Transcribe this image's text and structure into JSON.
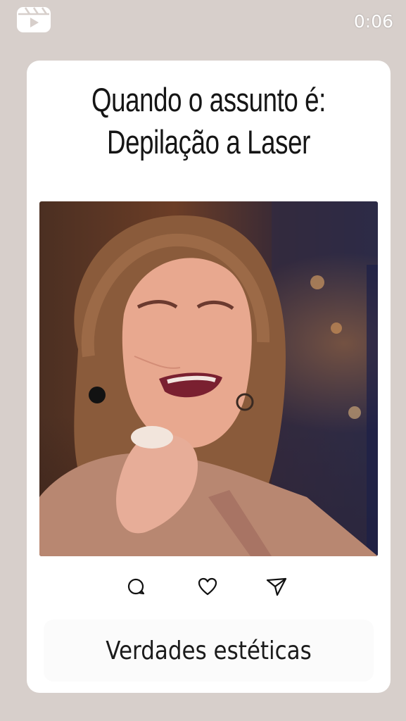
{
  "header": {
    "icon": "reels-icon",
    "timer": "0:06"
  },
  "post": {
    "title_line1": "Quando o assunto é:",
    "title_line2": "Depilação a Laser",
    "video_icon": "video-frame",
    "actions": [
      {
        "icon": "comment-icon"
      },
      {
        "icon": "heart-icon"
      },
      {
        "icon": "share-icon"
      }
    ],
    "caption": "Verdades estéticas"
  },
  "colors": {
    "background": "#d7cfcb",
    "card": "#ffffff",
    "text": "#151515"
  }
}
